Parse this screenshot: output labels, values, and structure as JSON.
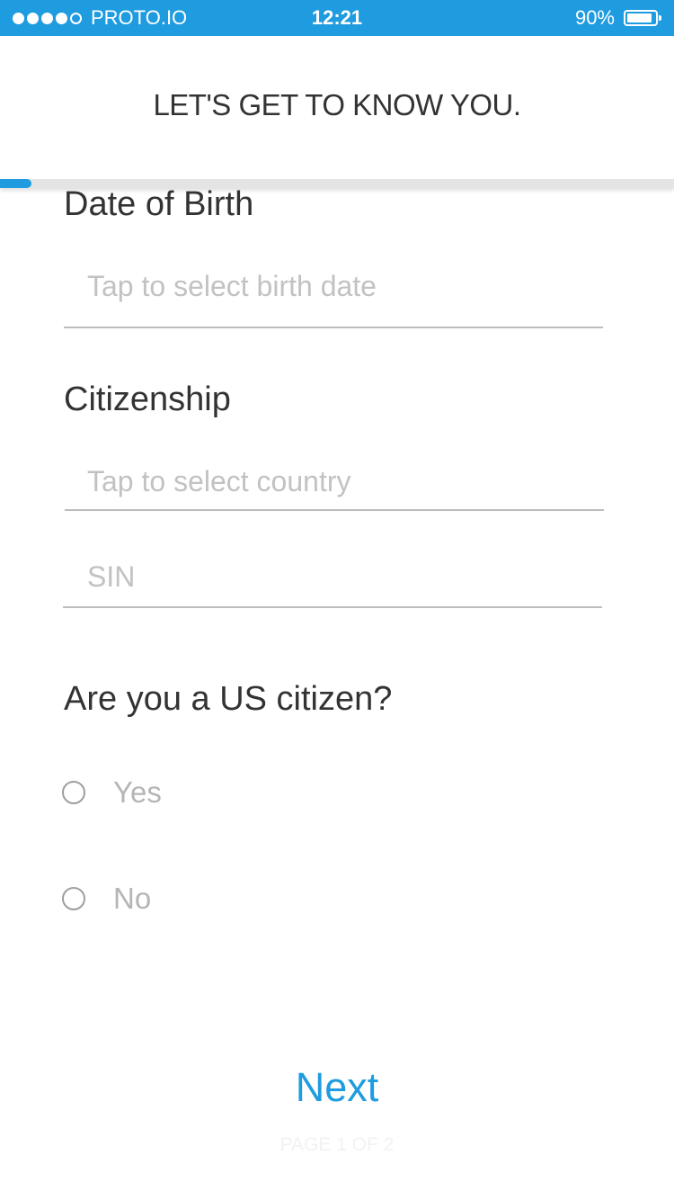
{
  "status_bar": {
    "carrier": "PROTO.IO",
    "signal_bars_filled": 4,
    "signal_bars_total": 5,
    "time": "12:21",
    "battery_percent": "90%",
    "battery_level": 0.9,
    "color": "#1f9be0"
  },
  "header": {
    "title": "LET'S GET TO KNOW YOU."
  },
  "progress": {
    "fraction": 0.047,
    "color": "#1f9be0"
  },
  "dob": {
    "label": "Date of Birth",
    "placeholder": "Tap to select birth date"
  },
  "citizenship": {
    "label": "Citizenship",
    "country_placeholder": "Tap to select country",
    "sin_placeholder": "SIN"
  },
  "us_citizen": {
    "question": "Are you a US citizen?",
    "options": [
      {
        "label": "Yes",
        "selected": false
      },
      {
        "label": "No",
        "selected": false
      }
    ]
  },
  "footer": {
    "next_label": "Next",
    "page_indicator": "PAGE 1 OF 2"
  }
}
